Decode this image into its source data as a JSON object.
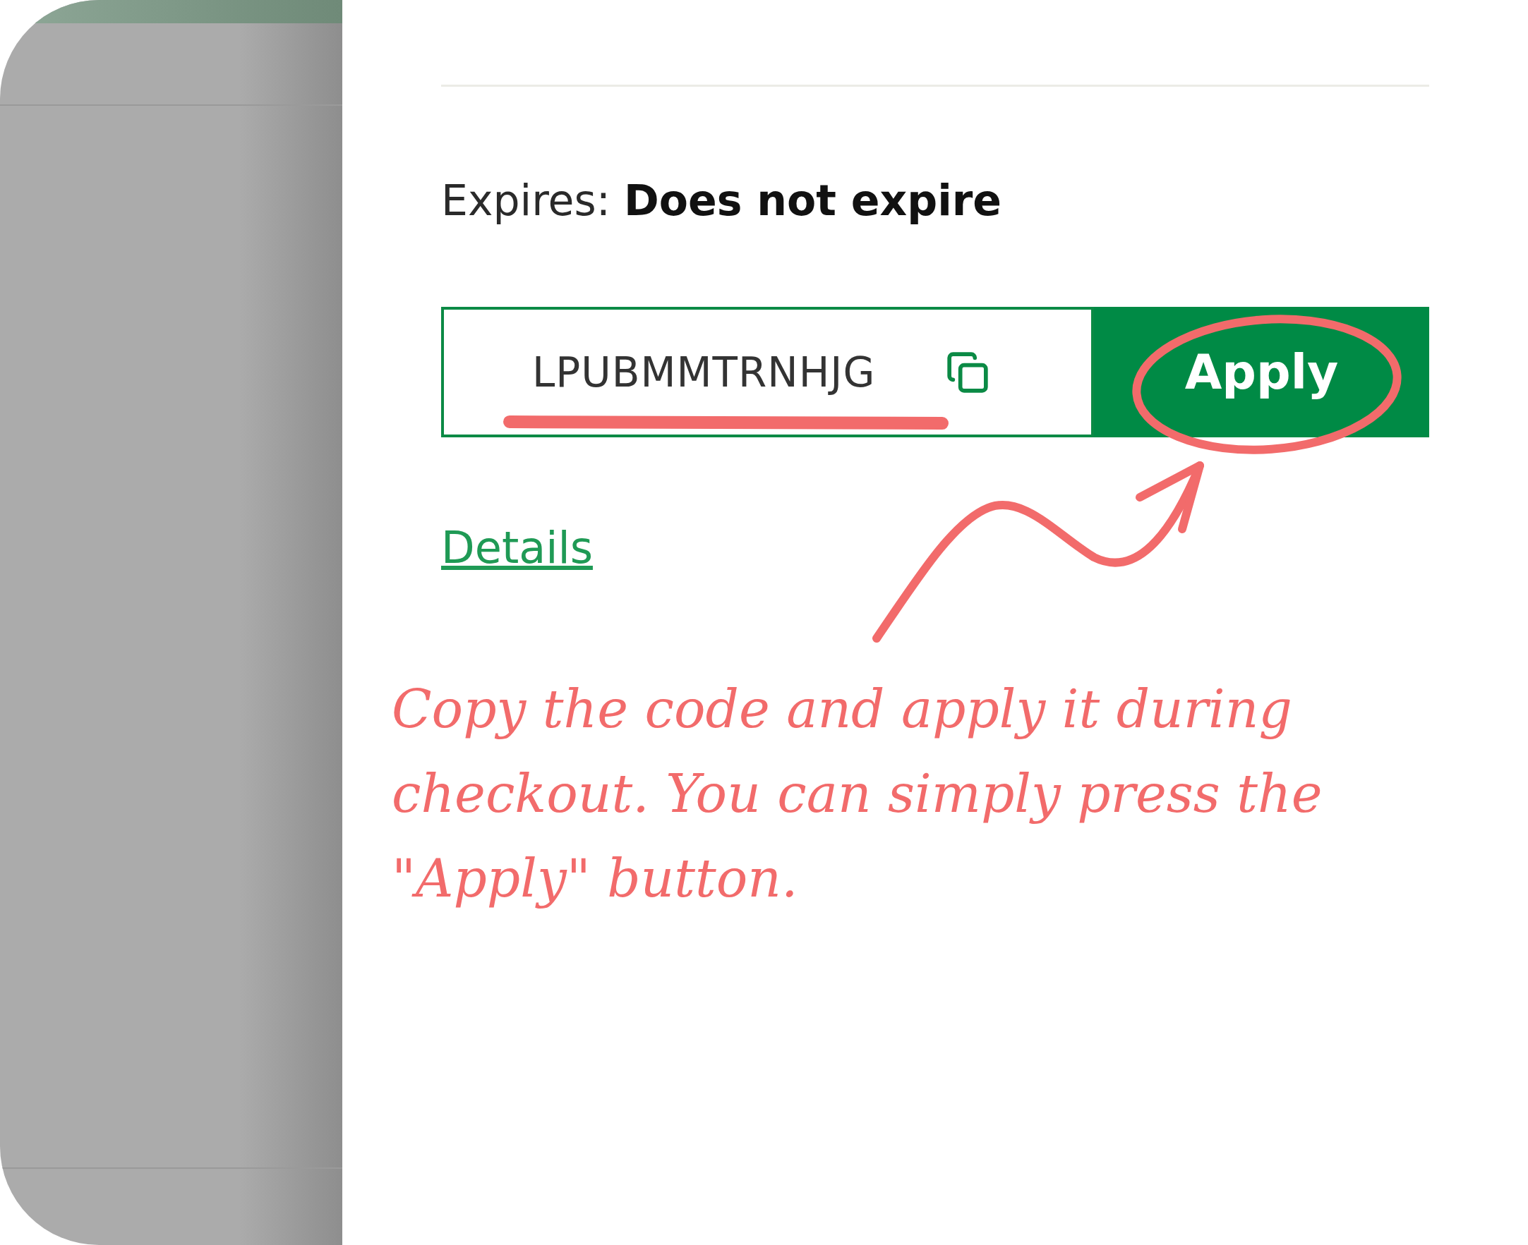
{
  "expires": {
    "text": "Expires: **Does not expire**"
  },
  "coupon": {
    "code": "LPUBMMTRNHJG",
    "apply_button": "Apply"
  },
  "details_link": "Details",
  "annotation": {
    "text": "Copy the code and apply it during checkout. You can simply press the \"Apply\" button."
  }
}
